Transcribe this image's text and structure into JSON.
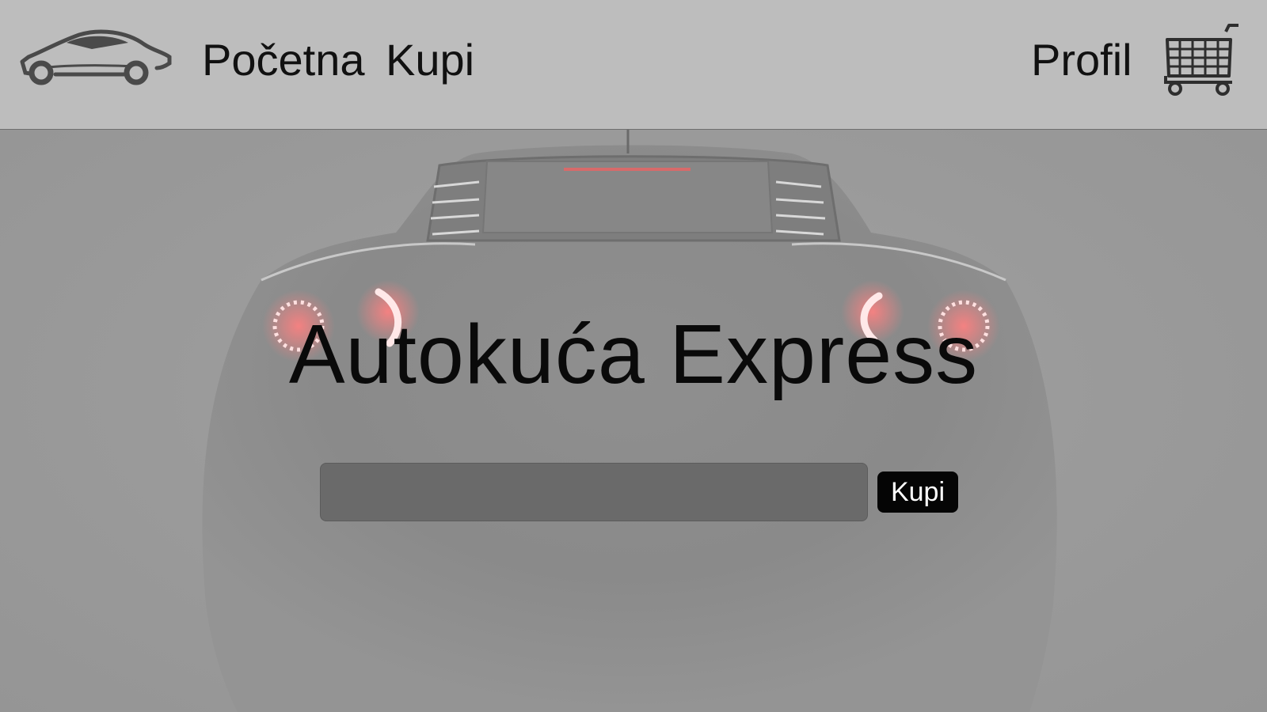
{
  "header": {
    "logo_icon": "car-logo-icon",
    "nav": {
      "home_label": "Početna",
      "buy_label": "Kupi",
      "profile_label": "Profil"
    },
    "cart_icon": "shopping-cart-icon"
  },
  "hero": {
    "background_image": "sports-car-rear-view",
    "title": "Autokuća Express",
    "search": {
      "value": "",
      "placeholder": ""
    },
    "buy_button_label": "Kupi"
  },
  "colors": {
    "header_bg": "#bdbdbd",
    "hero_bg": "#9a9a9a",
    "input_bg": "#6a6a6a",
    "button_bg": "#050505",
    "tail_light": "#ff5a5a"
  }
}
